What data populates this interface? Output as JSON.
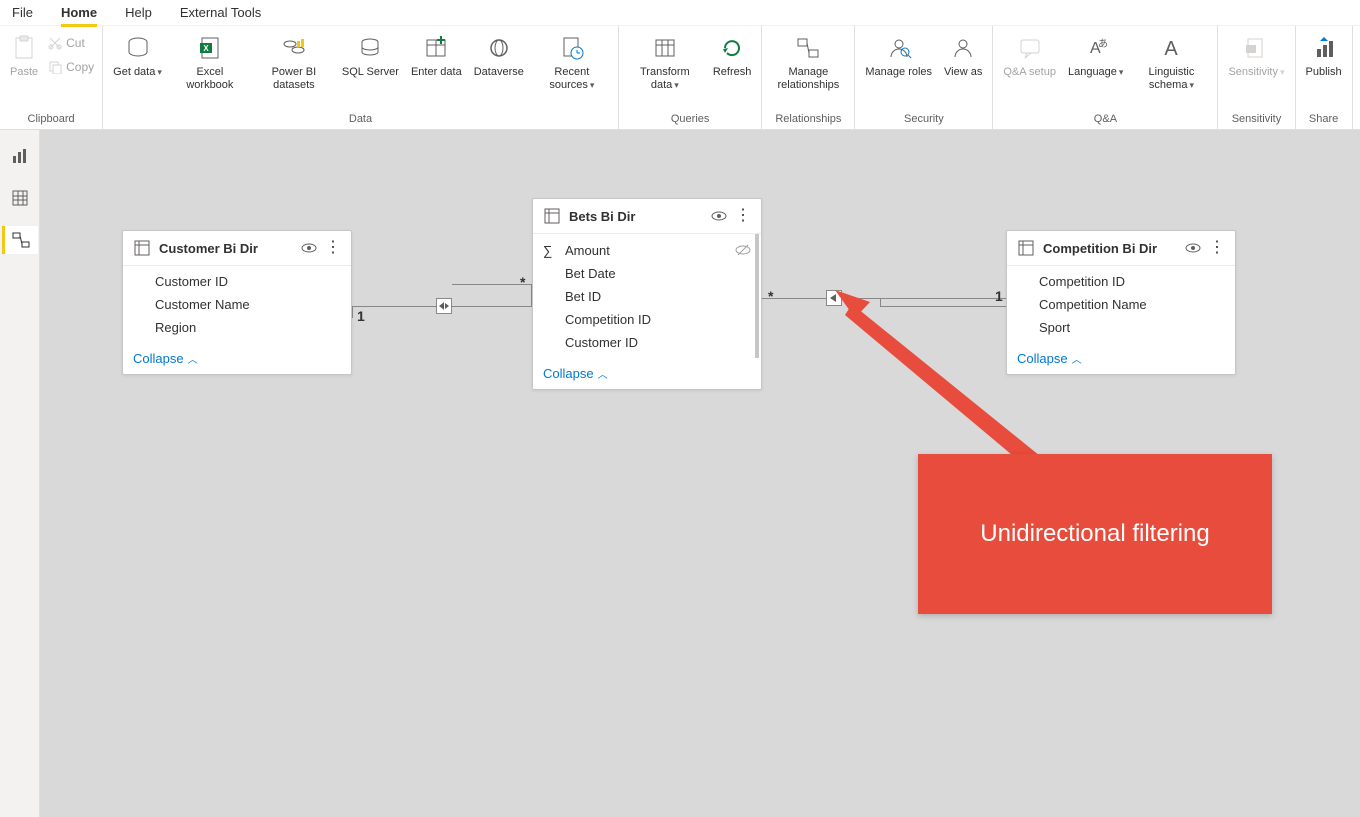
{
  "menubar": {
    "file": "File",
    "home": "Home",
    "help": "Help",
    "external": "External Tools"
  },
  "ribbon": {
    "clipboard": {
      "label": "Clipboard",
      "paste": "Paste",
      "cut": "Cut",
      "copy": "Copy"
    },
    "data": {
      "label": "Data",
      "getdata": "Get data",
      "excel": "Excel workbook",
      "pbids": "Power BI datasets",
      "sql": "SQL Server",
      "enterdata": "Enter data",
      "dataverse": "Dataverse",
      "recent": "Recent sources"
    },
    "queries": {
      "label": "Queries",
      "transform": "Transform data",
      "refresh": "Refresh"
    },
    "relationships": {
      "label": "Relationships",
      "manage": "Manage relationships"
    },
    "security": {
      "label": "Security",
      "manageroles": "Manage roles",
      "viewas": "View as"
    },
    "qa": {
      "label": "Q&A",
      "setup": "Q&A setup",
      "language": "Language",
      "schema": "Linguistic schema"
    },
    "sensitivity": {
      "label": "Sensitivity",
      "btn": "Sensitivity"
    },
    "share": {
      "label": "Share",
      "publish": "Publish"
    }
  },
  "tables": {
    "customer": {
      "title": "Customer Bi Dir",
      "fields": [
        "Customer ID",
        "Customer Name",
        "Region"
      ],
      "collapse": "Collapse"
    },
    "bets": {
      "title": "Bets Bi Dir",
      "fields": [
        "Amount",
        "Bet Date",
        "Bet ID",
        "Competition ID",
        "Customer ID"
      ],
      "collapse": "Collapse"
    },
    "competition": {
      "title": "Competition Bi Dir",
      "fields": [
        "Competition ID",
        "Competition Name",
        "Sport"
      ],
      "collapse": "Collapse"
    }
  },
  "cardinality": {
    "one": "1",
    "many": "*"
  },
  "callout": {
    "text": "Unidirectional filtering"
  }
}
